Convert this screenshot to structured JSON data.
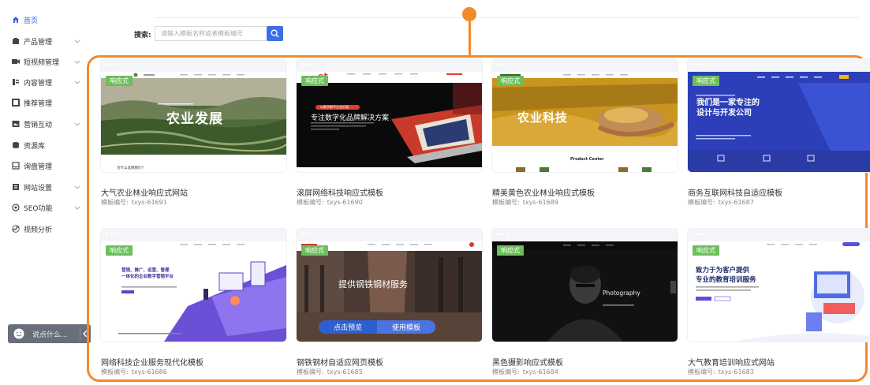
{
  "sidebar": {
    "items": [
      {
        "label": "首页",
        "icon": "home-icon",
        "active": true
      },
      {
        "label": "产品管理",
        "icon": "box-icon"
      },
      {
        "label": "短视频管理",
        "icon": "video-icon"
      },
      {
        "label": "内容管理",
        "icon": "list-icon"
      },
      {
        "label": "推荐管理",
        "icon": "square-icon"
      },
      {
        "label": "营销互动",
        "icon": "image-icon"
      },
      {
        "label": "资源库",
        "icon": "database-icon"
      },
      {
        "label": "询盘管理",
        "icon": "inbox-icon"
      },
      {
        "label": "网站设置",
        "icon": "settings-icon"
      },
      {
        "label": "SEO功能",
        "icon": "seo-icon"
      },
      {
        "label": "视频分析",
        "icon": "analytics-icon"
      }
    ],
    "chat": {
      "placeholder": "说点什么...",
      "icon": "smile-icon"
    }
  },
  "search": {
    "label": "搜索:",
    "placeholder": "请输入模板名称或者模板编号"
  },
  "colors": {
    "accent": "#3d6fe6",
    "highlight": "#f28a2b",
    "tag": "#6cbf5a"
  },
  "cards": [
    {
      "tag": "响应式",
      "title": "大气农业林业响应式网站",
      "code_label": "模板编号:",
      "code": "txys-61691",
      "shot_text": [
        "农业发展",
        "为什么选择我们?"
      ]
    },
    {
      "tag": "响应式",
      "title": "滚屏网络科技响应式模板",
      "code_label": "模板编号:",
      "code": "txys-61690",
      "shot_text": [
        "et",
        "以数字赋予企业价值",
        "专注数字化品牌解决方案"
      ]
    },
    {
      "tag": "响应式",
      "title": "精美黄色农业林业响应式模板",
      "code_label": "模板编号:",
      "code": "txys-61689",
      "shot_text": [
        "农业科技",
        "Product Center"
      ]
    },
    {
      "tag": "响应式",
      "title": "商务互联网科技自适应模板",
      "code_label": "模板编号:",
      "code": "txys-61687",
      "shot_text": [
        "我们是一家专注的",
        "设计与开发公司"
      ]
    },
    {
      "tag": "响应式",
      "title": "网络科技企业服务现代化模板",
      "code_label": "模板编号:",
      "code": "txys-61686",
      "shot_text": [
        "营销、推广、运营、管理",
        "一体化的企业数字营销平台"
      ]
    },
    {
      "tag": "响应式",
      "title": "钢铁钢材自适应网页模板",
      "code_label": "模板编号:",
      "code": "txys-61685",
      "shot_text": [
        "提供钢铁钢材服务"
      ],
      "actions": {
        "preview": "点击预览",
        "use": "使用模板"
      }
    },
    {
      "tag": "响应式",
      "title": "黑色摄影响应式模板",
      "code_label": "模板编号:",
      "code": "txys-61684",
      "shot_text": [
        "Photography"
      ]
    },
    {
      "tag": "响应式",
      "title": "大气教育培训响应式网站",
      "code_label": "模板编号:",
      "code": "txys-61683",
      "shot_text": [
        "致力于为客户提供",
        "专业的教育培训服务"
      ]
    }
  ]
}
